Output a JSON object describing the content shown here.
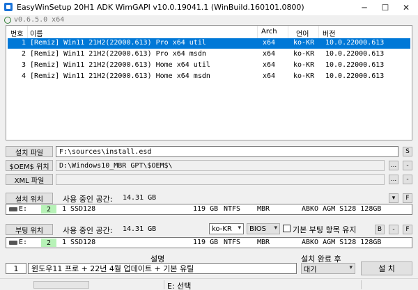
{
  "window": {
    "title": "EasyWinSetup   20H1 ADK   WimGAPI v10.0.19041.1 (WinBuild.160101.0800)",
    "version": "v0.6.5.0 x64",
    "min_glyph": "─",
    "max_glyph": "☐",
    "close_glyph": "✕"
  },
  "image_list": {
    "headers": {
      "num": "번호",
      "name": "이름",
      "arch": "Arch",
      "lang": "언어",
      "version": "버전"
    },
    "rows": [
      {
        "num": "1",
        "name": "[Remiz] Win11 21H2(22000.613) Pro x64 util",
        "arch": "x64",
        "lang": "ko-KR",
        "version": "10.0.22000.613",
        "selected": true
      },
      {
        "num": "2",
        "name": "[Remiz] Win11 21H2(22000.613) Pro x64 msdn",
        "arch": "x64",
        "lang": "ko-KR",
        "version": "10.0.22000.613",
        "selected": false
      },
      {
        "num": "3",
        "name": "[Remiz] Win11 21H2(22000.613) Home x64 util",
        "arch": "x64",
        "lang": "ko-KR",
        "version": "10.0.22000.613",
        "selected": false
      },
      {
        "num": "4",
        "name": "[Remiz] Win11 21H2(22000.613) Home x64 msdn",
        "arch": "x64",
        "lang": "ko-KR",
        "version": "10.0.22000.613",
        "selected": false
      }
    ]
  },
  "install_file": {
    "label": "설치 파일",
    "value": "F:\\sources\\install.esd",
    "side_button": "S"
  },
  "oem_location": {
    "label": "$OEM$ 위치",
    "value": "D:\\Windows10_MBR GPT\\$OEM$\\",
    "browse": "...",
    "clear": "-"
  },
  "xml_file": {
    "label": "XML 파일",
    "value": "",
    "browse": "...",
    "clear": "-"
  },
  "install_location": {
    "label": "설치 위치",
    "space_label": "사용 중인 공간:",
    "space_value": "14.31 GB",
    "dropdown_glyph": "▾",
    "side_button": "F",
    "drive": {
      "letter": "E:",
      "disk": "2",
      "part": "1",
      "name": "SSD128",
      "size": "119 GB",
      "fs": "NTFS",
      "table": "MBR",
      "model": "ABKO AGM S128 128GB"
    }
  },
  "boot_location": {
    "label": "부팅 위치",
    "space_label": "사용 중인 공간:",
    "space_value": "14.31 GB",
    "locale": "ko-KR",
    "firmware": "BIOS",
    "keep_entries_label": "기본 부팅 항목 유지",
    "keep_entries_checked": false,
    "btn_b": "B",
    "btn_minus": "-",
    "btn_f": "F",
    "drive": {
      "letter": "E:",
      "disk": "2",
      "part": "1",
      "name": "SSD128",
      "size": "119 GB",
      "fs": "NTFS",
      "table": "MBR",
      "model": "ABKO AGM S128 128GB"
    }
  },
  "description": {
    "header": "설명",
    "num": "1",
    "value": "윈도우11 프로 + 22년 4월 업데이트 + 기본 유틸"
  },
  "after_install": {
    "header": "설치 완료 후",
    "value": "대기"
  },
  "install_button": "설 치",
  "status": {
    "text": "E: 선택"
  }
}
